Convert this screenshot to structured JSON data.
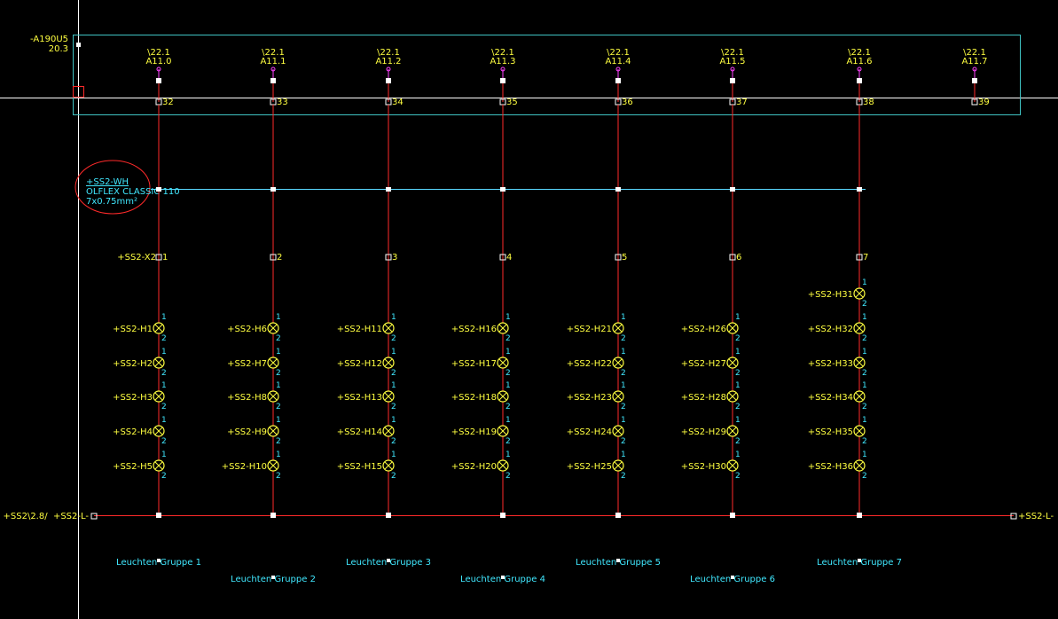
{
  "module": {
    "name": "-A190U5",
    "page": "20.3"
  },
  "columns": [
    {
      "ref": "\\22.1",
      "addr": "A11.0",
      "terminal": "32",
      "xterm": "1",
      "xterm_prefix": "+SS2-X2",
      "lamps": [
        "+SS2-H1",
        "+SS2-H2",
        "+SS2-H3",
        "+SS2-H4",
        "+SS2-H5"
      ],
      "group": "Leuchten Gruppe 1"
    },
    {
      "ref": "\\22.1",
      "addr": "A11.1",
      "terminal": "33",
      "xterm": "2",
      "lamps": [
        "+SS2-H6",
        "+SS2-H7",
        "+SS2-H8",
        "+SS2-H9",
        "+SS2-H10"
      ],
      "group": "Leuchten Gruppe 2"
    },
    {
      "ref": "\\22.1",
      "addr": "A11.2",
      "terminal": "34",
      "xterm": "3",
      "lamps": [
        "+SS2-H11",
        "+SS2-H12",
        "+SS2-H13",
        "+SS2-H14",
        "+SS2-H15"
      ],
      "group": "Leuchten Gruppe 3"
    },
    {
      "ref": "\\22.1",
      "addr": "A11.3",
      "terminal": "35",
      "xterm": "4",
      "lamps": [
        "+SS2-H16",
        "+SS2-H17",
        "+SS2-H18",
        "+SS2-H19",
        "+SS2-H20"
      ],
      "group": "Leuchten Gruppe 4"
    },
    {
      "ref": "\\22.1",
      "addr": "A11.4",
      "terminal": "36",
      "xterm": "5",
      "lamps": [
        "+SS2-H21",
        "+SS2-H22",
        "+SS2-H23",
        "+SS2-H24",
        "+SS2-H25"
      ],
      "group": "Leuchten Gruppe 5"
    },
    {
      "ref": "\\22.1",
      "addr": "A11.5",
      "terminal": "37",
      "xterm": "6",
      "lamps": [
        "+SS2-H26",
        "+SS2-H27",
        "+SS2-H28",
        "+SS2-H29",
        "+SS2-H30"
      ],
      "group": "Leuchten Gruppe 6"
    },
    {
      "ref": "\\22.1",
      "addr": "A11.6",
      "terminal": "38",
      "xterm": "7",
      "lamps": [
        "+SS2-H31",
        "+SS2-H32",
        "+SS2-H33",
        "+SS2-H34",
        "+SS2-H35",
        "+SS2-H36"
      ],
      "group": "Leuchten Gruppe 7"
    },
    {
      "ref": "\\22.1",
      "addr": "A11.7",
      "terminal": "39",
      "xterm": "",
      "lamps": [],
      "group": ""
    }
  ],
  "cable": {
    "name": "+SS2-WH",
    "type": "OLFLEX CLASSIC 110",
    "spec": "7x0.75mm²"
  },
  "pin_labels": {
    "top": "1",
    "bottom": "2"
  },
  "bus": {
    "left_label": "+SS2\\2.8/  +SS2-L-",
    "right_label": "+SS2-L-"
  },
  "colors": {
    "background": "#000000",
    "wire": "#ff2a2a",
    "text_yellow": "#ffff40",
    "text_cyan": "#40e8ff",
    "frame": "#3fc3c3",
    "cross": "#ffffff",
    "pin": "#ff40ff",
    "cable_line": "#5ad9ff"
  }
}
